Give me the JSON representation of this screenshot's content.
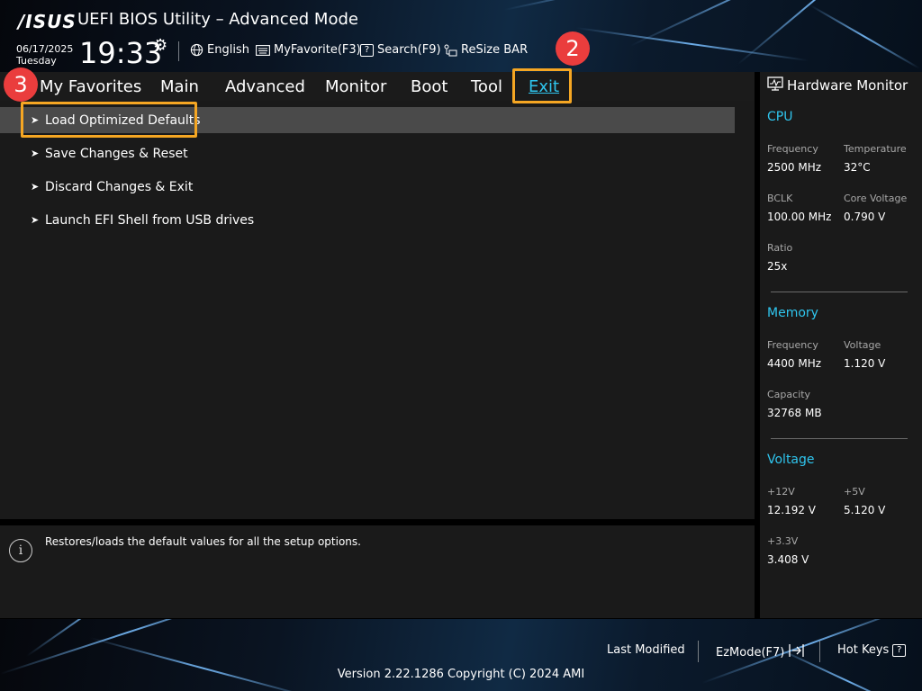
{
  "header": {
    "logo": "/ISUS",
    "title": "UEFI BIOS Utility – Advanced Mode",
    "date": "06/17/2025",
    "day": "Tuesday",
    "time": "19:33",
    "toolbar": {
      "language": "English",
      "myfavorite": "MyFavorite(F3)",
      "search": "Search(F9)",
      "resize_bar": "ReSize BAR"
    }
  },
  "nav": {
    "tabs": [
      {
        "label": "My Favorites"
      },
      {
        "label": "Main"
      },
      {
        "label": "Advanced"
      },
      {
        "label": "Monitor"
      },
      {
        "label": "Boot"
      },
      {
        "label": "Tool"
      },
      {
        "label": "Exit"
      }
    ],
    "active": "Exit"
  },
  "menu": {
    "items": [
      {
        "label": "Load Optimized Defaults"
      },
      {
        "label": "Save Changes & Reset"
      },
      {
        "label": "Discard Changes & Exit"
      },
      {
        "label": "Launch EFI Shell from USB drives"
      }
    ],
    "selected": "Load Optimized Defaults"
  },
  "help": {
    "text": "Restores/loads the default values for all the setup options."
  },
  "hardware_monitor": {
    "title": "Hardware Monitor",
    "cpu": {
      "heading": "CPU",
      "frequency_label": "Frequency",
      "frequency": "2500 MHz",
      "temperature_label": "Temperature",
      "temperature": "32°C",
      "bclk_label": "BCLK",
      "bclk": "100.00 MHz",
      "core_voltage_label": "Core Voltage",
      "core_voltage": "0.790 V",
      "ratio_label": "Ratio",
      "ratio": "25x"
    },
    "memory": {
      "heading": "Memory",
      "frequency_label": "Frequency",
      "frequency": "4400 MHz",
      "voltage_label": "Voltage",
      "voltage": "1.120 V",
      "capacity_label": "Capacity",
      "capacity": "32768 MB"
    },
    "voltage": {
      "heading": "Voltage",
      "v12_label": "+12V",
      "v12": "12.192 V",
      "v5_label": "+5V",
      "v5": "5.120 V",
      "v33_label": "+3.3V",
      "v33": "3.408 V"
    }
  },
  "footer": {
    "last_modified": "Last Modified",
    "ezmode": "EzMode(F7)",
    "hot_keys": "Hot Keys",
    "version": "Version 2.22.1286 Copyright (C) 2024 AMI"
  },
  "annotations": {
    "step_exit": "2",
    "step_load": "3",
    "highlight_color": "#f5a623",
    "badge_color": "#ea3d3d"
  },
  "colors": {
    "accent": "#2fc5ee",
    "selected_row": "#4a4a4a",
    "panel": "#1a1a1a"
  }
}
